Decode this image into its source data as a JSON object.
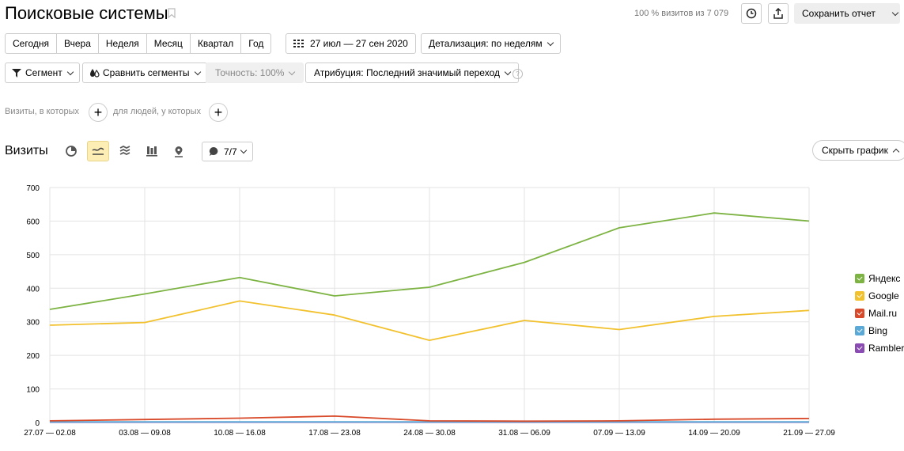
{
  "header": {
    "title": "Поисковые системы",
    "summary": "100 % визитов из 7 079",
    "save_label": "Сохранить отчет"
  },
  "periods": [
    "Сегодня",
    "Вчера",
    "Неделя",
    "Месяц",
    "Квартал",
    "Год"
  ],
  "date_range": "27 июл — 27 сен 2020",
  "detail": "Детализация: по неделям",
  "filters": {
    "segment": "Сегмент",
    "compare": "Сравнить сегменты",
    "accuracy": "Точность: 100%",
    "attribution": "Атрибуция: Последний значимый переход"
  },
  "segment_builder": {
    "visits_label": "Визиты, в которых",
    "people_label": "для людей, у которых"
  },
  "chart_header": {
    "title": "Визиты",
    "series_count": "7/7",
    "hide_label": "Скрыть график"
  },
  "chart_data": {
    "type": "line",
    "categories": [
      "27.07 — 02.08",
      "03.08 — 09.08",
      "10.08 — 16.08",
      "17.08 — 23.08",
      "24.08 — 30.08",
      "31.08 — 06.09",
      "07.09 — 13.09",
      "14.09 — 20.09",
      "21.09 — 27.09"
    ],
    "ylim": [
      0,
      700
    ],
    "yticks": [
      0,
      100,
      200,
      300,
      400,
      500,
      600,
      700
    ],
    "grid": true,
    "legend": "right",
    "series": [
      {
        "name": "Яндекс",
        "color": "#7cb342",
        "values": [
          337,
          383,
          432,
          377,
          403,
          477,
          580,
          624,
          600
        ]
      },
      {
        "name": "Google",
        "color": "#f2c12e",
        "values": [
          290,
          298,
          362,
          320,
          245,
          304,
          277,
          316,
          334
        ]
      },
      {
        "name": "Mail.ru",
        "color": "#d84a2a",
        "values": [
          5,
          9,
          13,
          19,
          5,
          4,
          5,
          10,
          12
        ]
      },
      {
        "name": "Bing",
        "color": "#5aa9d6",
        "values": [
          2,
          2,
          2,
          2,
          2,
          2,
          2,
          2,
          2
        ]
      },
      {
        "name": "Rambler",
        "color": "#8a4bb2",
        "values": [
          1,
          1,
          1,
          1,
          1,
          1,
          1,
          1,
          1
        ]
      }
    ]
  }
}
